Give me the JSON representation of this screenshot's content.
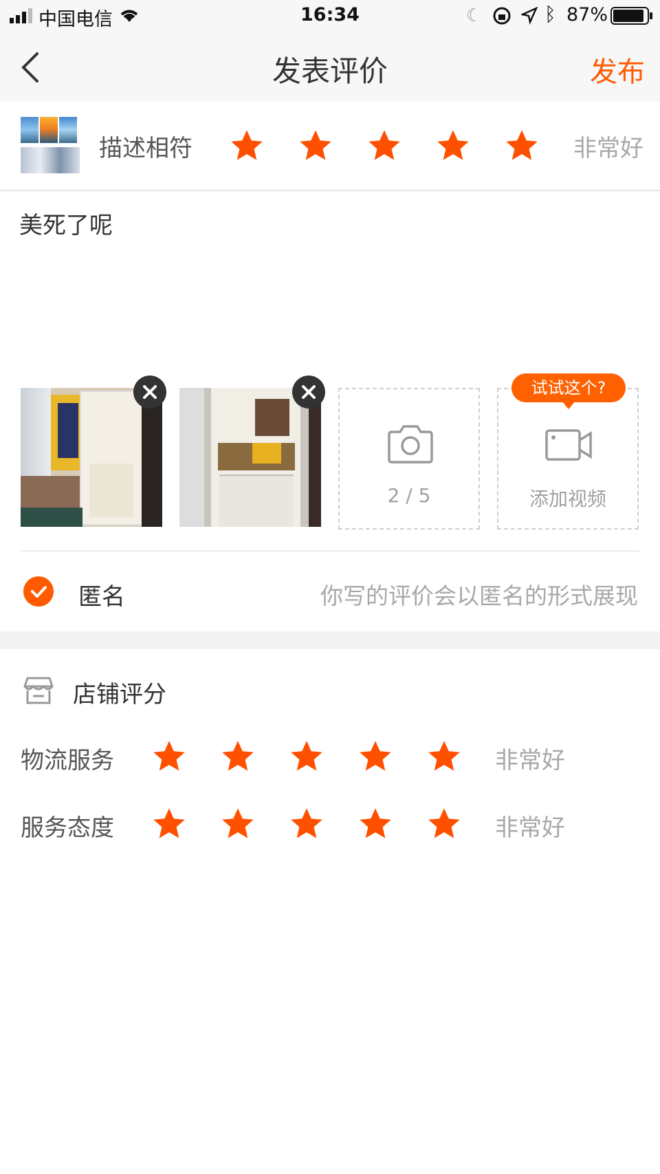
{
  "status_bar": {
    "carrier": "中国电信",
    "time": "16:34",
    "battery": "87%"
  },
  "nav": {
    "title": "发表评价",
    "publish": "发布"
  },
  "product_rating": {
    "label": "描述相符",
    "stars": 5,
    "level_text": "非常好"
  },
  "review": {
    "text": "美死了呢"
  },
  "media": {
    "photo_counter": "2 / 5",
    "add_video": "添加视频",
    "tooltip": "试试这个?"
  },
  "anonymous": {
    "label": "匿名",
    "hint": "你写的评价会以匿名的形式展现",
    "checked": true
  },
  "shop_rating": {
    "title": "店铺评分",
    "rows": [
      {
        "label": "物流服务",
        "stars": 5,
        "level_text": "非常好"
      },
      {
        "label": "服务态度",
        "stars": 5,
        "level_text": "非常好"
      }
    ]
  },
  "colors": {
    "accent": "#ff5a00",
    "star": "#ff5000",
    "tooltip": "#ff6000"
  }
}
